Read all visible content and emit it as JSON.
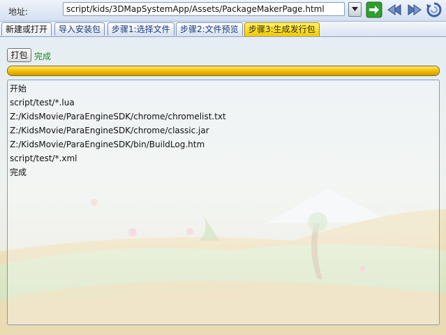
{
  "address": {
    "label": "地址:",
    "value": "script/kids/3DMapSystemApp/Assets/PackageMakerPage.html"
  },
  "nav": {
    "go_icon": "go-arrow-icon",
    "back_icon": "back-icon",
    "forward_icon": "forward-icon",
    "refresh_icon": "refresh-icon"
  },
  "tabs": [
    {
      "label": "新建或打开"
    },
    {
      "label": "导入安装包"
    },
    {
      "label": "步骤1:选择文件"
    },
    {
      "label": "步骤2:文件预览"
    },
    {
      "label": "步骤3:生成发行包"
    }
  ],
  "active_tab": 4,
  "toolbar": {
    "pack_label": "打包",
    "status_text": "完成"
  },
  "progress": {
    "fraction": 1.0
  },
  "log": {
    "lines": [
      "开始",
      "script/test/*.lua",
      "Z:/KidsMovie/ParaEngineSDK/chrome/chromelist.txt",
      "Z:/KidsMovie/ParaEngineSDK/chrome/classic.jar",
      "Z:/KidsMovie/ParaEngineSDK/bin/BuildLog.htm",
      "script/test/*.xml",
      "完成"
    ]
  },
  "colors": {
    "status_green": "#1c8a1c",
    "progress_gold": "#f5c400",
    "active_tab": "#fff36a"
  }
}
